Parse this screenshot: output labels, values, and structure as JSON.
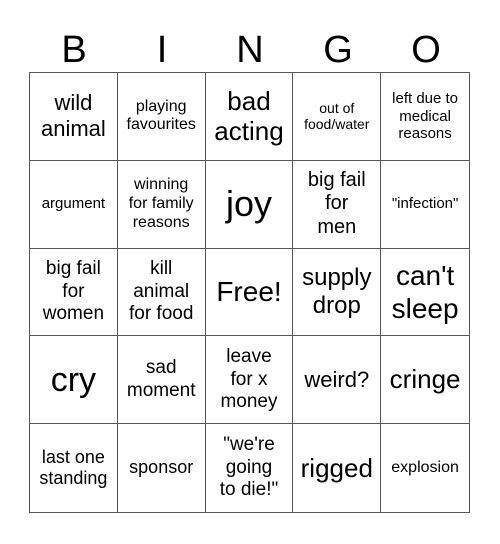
{
  "header": [
    "B",
    "I",
    "N",
    "G",
    "O"
  ],
  "cells": [
    "wild\nanimal",
    "playing\nfavourites",
    "bad\nacting",
    "out of\nfood/water",
    "left due to\nmedical\nreasons",
    "argument",
    "winning\nfor family\nreasons",
    "joy",
    "big fail\nfor\nmen",
    "\"infection\"",
    "big fail\nfor\nwomen",
    "kill\nanimal\nfor food",
    "Free!",
    "supply\ndrop",
    "can't\nsleep",
    "cry",
    "sad\nmoment",
    "leave\nfor x\nmoney",
    "weird?",
    "cringe",
    "last one\nstanding",
    "sponsor",
    "\"we're\ngoing\nto die!\"",
    "rigged",
    "explosion"
  ]
}
